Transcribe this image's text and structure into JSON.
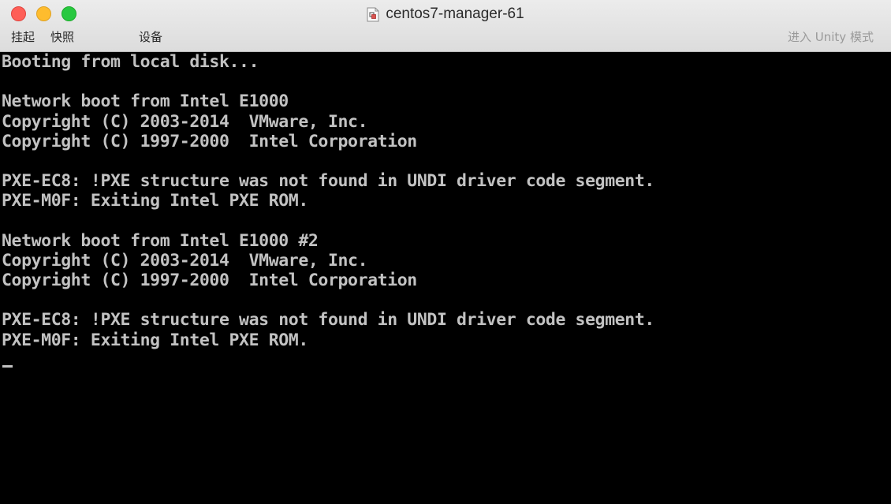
{
  "window": {
    "title": "centos7-manager-61",
    "title_icon": "vmware-vm-icon",
    "controls": {
      "close_color": "#fe5f57",
      "minimize_color": "#febc2e",
      "maximize_color": "#28c840"
    }
  },
  "toolbar": {
    "suspend_label": "挂起",
    "snapshot_label": "快照",
    "devices_label": "设备",
    "unity_label": "进入 Unity 模式"
  },
  "console": {
    "lines": [
      "Booting from local disk...",
      "",
      "Network boot from Intel E1000",
      "Copyright (C) 2003-2014  VMware, Inc.",
      "Copyright (C) 1997-2000  Intel Corporation",
      "",
      "PXE-EC8: !PXE structure was not found in UNDI driver code segment.",
      "PXE-M0F: Exiting Intel PXE ROM.",
      "",
      "Network boot from Intel E1000 #2",
      "Copyright (C) 2003-2014  VMware, Inc.",
      "Copyright (C) 1997-2000  Intel Corporation",
      "",
      "PXE-EC8: !PXE structure was not found in UNDI driver code segment.",
      "PXE-M0F: Exiting Intel PXE ROM."
    ],
    "text_color": "#c2c2c2",
    "background_color": "#000000"
  }
}
